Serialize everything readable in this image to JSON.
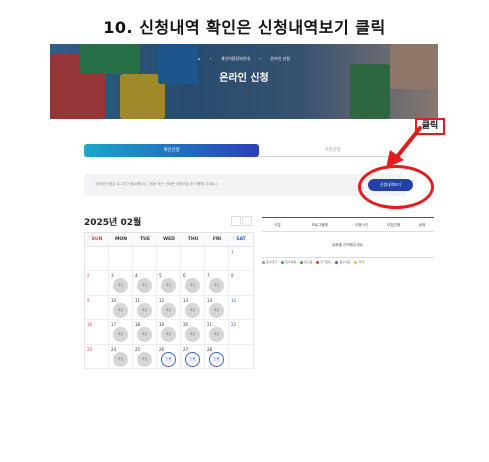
{
  "step_title": "10. 신청내역 확인은 신청내역보기 클릭",
  "hero": {
    "breadcrumb": [
      "⌂",
      "개인이용정보안내",
      "온라인 신청"
    ],
    "heading": "온라인 신청"
  },
  "tabs": {
    "active": "개인신청",
    "inactive": "기관신청"
  },
  "notice": {
    "message": "· 온라인신청은 로그인이 필요합니다. (평균 또는 언제든 회원가입 후 이용해 주세요.)",
    "button": "신청내역보기"
  },
  "callout": {
    "label": "클릭"
  },
  "calendar": {
    "month_title": "2025년 02월",
    "weekdays": [
      "SUN",
      "MON",
      "TUE",
      "WED",
      "THU",
      "FRI",
      "SAT"
    ],
    "weeks": [
      [
        null,
        null,
        null,
        null,
        null,
        null,
        {
          "d": "1",
          "s": ""
        }
      ],
      [
        {
          "d": "2",
          "s": ""
        },
        {
          "d": "3",
          "s": "마감"
        },
        {
          "d": "4",
          "s": "마감"
        },
        {
          "d": "5",
          "s": "마감"
        },
        {
          "d": "6",
          "s": "마감"
        },
        {
          "d": "7",
          "s": "마감"
        },
        {
          "d": "8",
          "s": ""
        }
      ],
      [
        {
          "d": "9",
          "s": ""
        },
        {
          "d": "10",
          "s": "마감"
        },
        {
          "d": "11",
          "s": "마감"
        },
        {
          "d": "12",
          "s": "마감"
        },
        {
          "d": "13",
          "s": "마감"
        },
        {
          "d": "14",
          "s": "마감"
        },
        {
          "d": "15",
          "s": ""
        }
      ],
      [
        {
          "d": "16",
          "s": ""
        },
        {
          "d": "17",
          "s": "마감"
        },
        {
          "d": "18",
          "s": "마감"
        },
        {
          "d": "19",
          "s": "마감"
        },
        {
          "d": "20",
          "s": "마감"
        },
        {
          "d": "21",
          "s": "마감"
        },
        {
          "d": "22",
          "s": ""
        }
      ],
      [
        {
          "d": "23",
          "s": ""
        },
        {
          "d": "24",
          "s": "마감"
        },
        {
          "d": "25",
          "s": "마감"
        },
        {
          "d": "26",
          "s": "신청"
        },
        {
          "d": "27",
          "s": "신청"
        },
        {
          "d": "28",
          "s": "신청"
        },
        null
      ]
    ]
  },
  "apply_table": {
    "columns": [
      "구분",
      "프로그램명",
      "이용시간",
      "모집인원",
      "상태"
    ],
    "empty_message": "날짜를 선택해주세요."
  },
  "legend": [
    {
      "label": "접수대기",
      "color": "#999999"
    },
    {
      "label": "접수예정",
      "color": "#2a9d8f"
    },
    {
      "label": "접수중",
      "color": "#3aa845"
    },
    {
      "label": "추가접수",
      "color": "#e03a3a"
    },
    {
      "label": "접수마감",
      "color": "#8e44ad"
    },
    {
      "label": "기타",
      "color": "#f2c21b"
    }
  ],
  "colors": {
    "accent": "#2340a8",
    "highlight": "#e31c1c"
  }
}
